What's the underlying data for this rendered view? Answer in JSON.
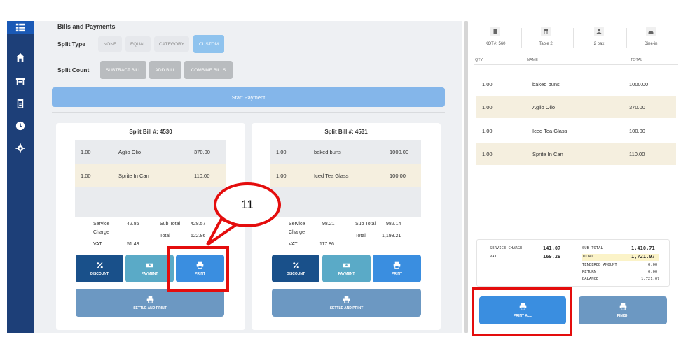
{
  "main": {
    "title": "Bills and Payments",
    "split_type_label": "Split Type",
    "split_types": [
      "NONE",
      "EQUAL",
      "CATEGORY",
      "CUSTOM"
    ],
    "active_split_type": "CUSTOM",
    "split_count_label": "Split Count",
    "split_count_buttons": [
      "SUBTRACT BILL",
      "ADD BILL",
      "COMBINE BILLS"
    ],
    "start_payment": "Start Payment"
  },
  "bills": [
    {
      "title": "Split Bill #: 4530",
      "items": [
        {
          "qty": "1.00",
          "name": "Aglio Olio",
          "total": "370.00"
        },
        {
          "qty": "1.00",
          "name": "Sprite In Can",
          "total": "110.00"
        }
      ],
      "service_charge_label": "Service",
      "service_charge_label2": "Charge",
      "service_charge": "42.86",
      "vat_label": "VAT",
      "vat": "51.43",
      "subtotal_label": "Sub Total",
      "subtotal": "428.57",
      "total_label": "Total",
      "total": "522.86"
    },
    {
      "title": "Split Bill #: 4531",
      "items": [
        {
          "qty": "1.00",
          "name": "baked buns",
          "total": "1000.00"
        },
        {
          "qty": "1.00",
          "name": "Iced Tea Glass",
          "total": "100.00"
        }
      ],
      "service_charge_label": "Service",
      "service_charge_label2": "Charge",
      "service_charge": "98.21",
      "vat_label": "VAT",
      "vat": "117.86",
      "subtotal_label": "Sub Total",
      "subtotal": "982.14",
      "total_label": "Total",
      "total": "1,198.21"
    }
  ],
  "bill_actions": {
    "discount": "DISCOUNT",
    "payment": "PAYMENT",
    "print": "PRINT",
    "settle_print": "SETTLE AND PRINT"
  },
  "order": {
    "header": {
      "kot": "KOT#: 560",
      "table": "Table 2",
      "pax": "2 pax",
      "mode": "Dine-in"
    },
    "columns": {
      "qty": "QTY",
      "name": "NAME",
      "total": "TOTAL"
    },
    "items": [
      {
        "qty": "1.00",
        "name": "baked buns",
        "total": "1000.00"
      },
      {
        "qty": "1.00",
        "name": "Aglio Olio",
        "total": "370.00"
      },
      {
        "qty": "1.00",
        "name": "Iced Tea Glass",
        "total": "100.00"
      },
      {
        "qty": "1.00",
        "name": "Sprite In Can",
        "total": "110.00"
      }
    ],
    "totals": {
      "service_charge_label": "SERVICE CHARGE",
      "service_charge": "141.07",
      "vat_label": "VAT",
      "vat": "169.29",
      "subtotal_label": "SUB TOTAL",
      "subtotal": "1,410.71",
      "total_label": "TOTAL",
      "total": "1,721.07",
      "tendered_label": "TENDERED AMOUNT",
      "tendered": "0.00",
      "return_label": "RETURN",
      "return": "0.00",
      "balance_label": "BALANCE",
      "balance": "1,721.07"
    },
    "print_all": "PRINT ALL",
    "finish": "FINISH"
  },
  "annotation": {
    "callout_number": "11",
    "color": "#e40d0d"
  },
  "colors": {
    "sidebar": "#1d3f78",
    "accent": "#3a8ee0",
    "discount": "#19508a",
    "payment": "#5aaac7",
    "settle": "#6c98c2"
  }
}
